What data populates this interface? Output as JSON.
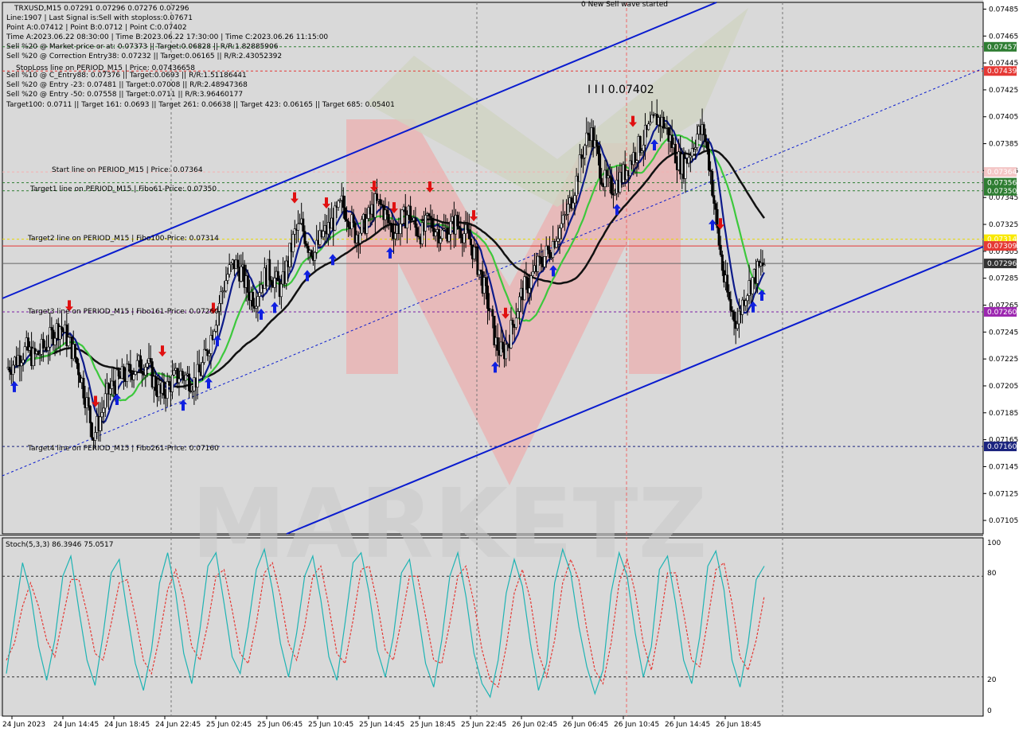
{
  "header": {
    "symbol_line": "TRXUSD,M15  0.07291 0.07296 0.07276 0.07296",
    "info_lines": [
      "Line:1907 | Last Signal is:Sell with stoploss:0.07671",
      "Point A:0.07412 | Point B:0.0712 | Point C:0.07402",
      "Time A:2023.06.22 08:30:00 | Time B:2023.06.22 17:30:00 | Time C:2023.06.26 11:15:00",
      "Sell %20 @ Market price or at: 0.07373 || Target:0.06828 || R/R:1.82885906",
      "Sell %20 @ Correction Entry38: 0.07232 || Target:0.06165 || R/R:2.43052392",
      "Sell %10 @ C_Entry88: 0.07376 || Target:0.0693 || R/R:1.51186441",
      "Sell %20 @ Entry -23: 0.07481 || Target:0.07008 || R/R:2.48947368",
      "Sell %20 @ Entry -50: 0.07558 || Target:0.0711 || R/R:3.96460177",
      "Target100: 0.0711 || Target 161: 0.0693 || Target 261: 0.06638 || Target 423: 0.06165 || Target 685: 0.05401"
    ],
    "overlap_text": "StopLoss line on PERIOD_M15 | Price: 0.07436658",
    "sell_wave_text": "0 New Sell wave started",
    "peak_label": "I I I 0.07402"
  },
  "level_annotations": {
    "start_line": "Start line on PERIOD_M15 | Price: 0.07364",
    "target1": "Target1 line on PERIOD_M15 | Fibo61-Price: 0.07350",
    "target2": "Target2 line on PERIOD_M15 | Fibo100-Price: 0.07314",
    "target3": "Target3 line on PERIOD_M15 | Fibo161-Price: 0.07260",
    "target4": "Target4 line on PERIOD_M15 | Fibo261-Price: 0.07160"
  },
  "price_tags": [
    {
      "value": "0.07457",
      "color": "#2e7d32"
    },
    {
      "value": "0.07439",
      "color": "#e53935"
    },
    {
      "value": "0.07364",
      "color": "#f4c7c7"
    },
    {
      "value": "0.07356",
      "color": "#2e7d32"
    },
    {
      "value": "0.07350",
      "color": "#2e7d32"
    },
    {
      "value": "0.07314",
      "color": "#f9e900"
    },
    {
      "value": "0.07309",
      "color": "#e53935"
    },
    {
      "value": "0.07296",
      "color": "#333333"
    },
    {
      "value": "0.07260",
      "color": "#9c27b0"
    },
    {
      "value": "0.07160",
      "color": "#1a237e"
    }
  ],
  "oscillator": {
    "label": "Stoch(5,3,3) 86.3946 75.0517",
    "levels": [
      "100",
      "80",
      "20",
      "0"
    ]
  },
  "colors": {
    "background": "#d9d9d9",
    "channel": "#0a1ccf",
    "ma_fast": "#0d1b8a",
    "ma_mid": "#3cc83c",
    "ma_slow": "#111111",
    "stoch_main": "#1eb4b4",
    "stoch_signal": "#e53935",
    "watermark": "#f2a0a0"
  },
  "chart_data": [
    {
      "type": "candlestick",
      "title": "TRXUSD,M15",
      "ylim": [
        0.07095,
        0.0749
      ],
      "y_ticks": [
        "0.07485",
        "0.07465",
        "0.07445",
        "0.07425",
        "0.07405",
        "0.07385",
        "0.07365",
        "0.07345",
        "0.07325",
        "0.07305",
        "0.07285",
        "0.07265",
        "0.07245",
        "0.07225",
        "0.07205",
        "0.07185",
        "0.07165",
        "0.07145",
        "0.07125",
        "0.07105"
      ],
      "x_ticks": [
        "24 Jun 2023",
        "24 Jun 14:45",
        "24 Jun 18:45",
        "24 Jun 22:45",
        "25 Jun 02:45",
        "25 Jun 06:45",
        "25 Jun 10:45",
        "25 Jun 14:45",
        "25 Jun 18:45",
        "25 Jun 22:45",
        "26 Jun 02:45",
        "26 Jun 06:45",
        "26 Jun 10:45",
        "26 Jun 14:45",
        "26 Jun 18:45"
      ],
      "close_path": [
        0.07218,
        0.07222,
        0.07228,
        0.07232,
        0.07226,
        0.0723,
        0.07236,
        0.07244,
        0.0725,
        0.07241,
        0.0723,
        0.07214,
        0.07192,
        0.07168,
        0.07182,
        0.07198,
        0.07206,
        0.0721,
        0.07214,
        0.07218,
        0.07221,
        0.07222,
        0.07208,
        0.07198,
        0.07204,
        0.0721,
        0.07214,
        0.07211,
        0.07208,
        0.07216,
        0.07232,
        0.07252,
        0.07272,
        0.07288,
        0.07296,
        0.0729,
        0.07276,
        0.0727,
        0.07282,
        0.0729,
        0.07284,
        0.07276,
        0.07298,
        0.07318,
        0.07324,
        0.0731,
        0.07304,
        0.07316,
        0.07322,
        0.0733,
        0.0734,
        0.07332,
        0.07318,
        0.07322,
        0.0733,
        0.0734,
        0.07338,
        0.07326,
        0.0732,
        0.07328,
        0.07334,
        0.07322,
        0.07318,
        0.07328,
        0.07322,
        0.07318,
        0.07322,
        0.07326,
        0.0732,
        0.07314,
        0.073,
        0.07282,
        0.07262,
        0.07236,
        0.07228,
        0.07242,
        0.0726,
        0.07276,
        0.07282,
        0.07292,
        0.073,
        0.07306,
        0.07318,
        0.07326,
        0.0734,
        0.07358,
        0.0738,
        0.07396,
        0.07378,
        0.07358,
        0.07352,
        0.07356,
        0.07362,
        0.07372,
        0.0738,
        0.07388,
        0.07396,
        0.07404,
        0.074,
        0.07388,
        0.07374,
        0.07368,
        0.0738,
        0.07392,
        0.07394,
        0.07364,
        0.0732,
        0.07284,
        0.07262,
        0.07252,
        0.07272,
        0.07282,
        0.0729,
        0.07296
      ],
      "stop_loss_levels": [
        {
          "name": "Stop loss",
          "value": 0.07439
        },
        {
          "name": "Start",
          "value": 0.07364
        },
        {
          "name": "Target1",
          "value": 0.0735
        },
        {
          "name": "Target2",
          "value": 0.07314
        },
        {
          "name": "Target3",
          "value": 0.0726
        },
        {
          "name": "Target4",
          "value": 0.0716
        }
      ],
      "last_price": 0.07296
    },
    {
      "type": "line",
      "title": "Stoch(5,3,3) 86.3946 75.0517",
      "ylim": [
        0,
        100
      ],
      "levels": [
        80,
        20
      ],
      "series": [
        {
          "values": [
            22,
            55,
            88,
            70,
            38,
            18,
            42,
            80,
            92,
            60,
            30,
            15,
            45,
            82,
            90,
            58,
            28,
            12,
            36,
            76,
            94,
            70,
            34,
            16,
            48,
            86,
            94,
            64,
            32,
            22,
            50,
            84,
            96,
            72,
            40,
            20,
            46,
            80,
            92,
            66,
            32,
            18,
            52,
            88,
            94,
            70,
            36,
            20,
            44,
            82,
            90,
            60,
            28,
            14,
            42,
            80,
            94,
            68,
            34,
            16,
            8,
            30,
            70,
            90,
            74,
            40,
            12,
            28,
            76,
            96,
            82,
            50,
            26,
            10,
            24,
            70,
            94,
            80,
            46,
            20,
            38,
            84,
            92,
            64,
            30,
            16,
            44,
            86,
            95,
            72,
            30,
            14,
            40,
            78,
            86
          ]
        },
        {
          "values": [
            30,
            40,
            62,
            76,
            62,
            42,
            32,
            55,
            78,
            78,
            58,
            34,
            30,
            52,
            76,
            78,
            56,
            30,
            22,
            44,
            72,
            84,
            66,
            38,
            30,
            52,
            80,
            84,
            60,
            34,
            28,
            52,
            82,
            88,
            68,
            40,
            30,
            50,
            80,
            86,
            62,
            34,
            28,
            54,
            84,
            86,
            64,
            36,
            30,
            54,
            80,
            80,
            56,
            30,
            28,
            52,
            80,
            86,
            64,
            36,
            18,
            14,
            38,
            70,
            84,
            66,
            34,
            20,
            42,
            76,
            90,
            78,
            48,
            24,
            16,
            40,
            76,
            90,
            70,
            40,
            24,
            50,
            82,
            82,
            58,
            30,
            26,
            54,
            84,
            88,
            64,
            32,
            24,
            42,
            68
          ]
        }
      ]
    }
  ]
}
